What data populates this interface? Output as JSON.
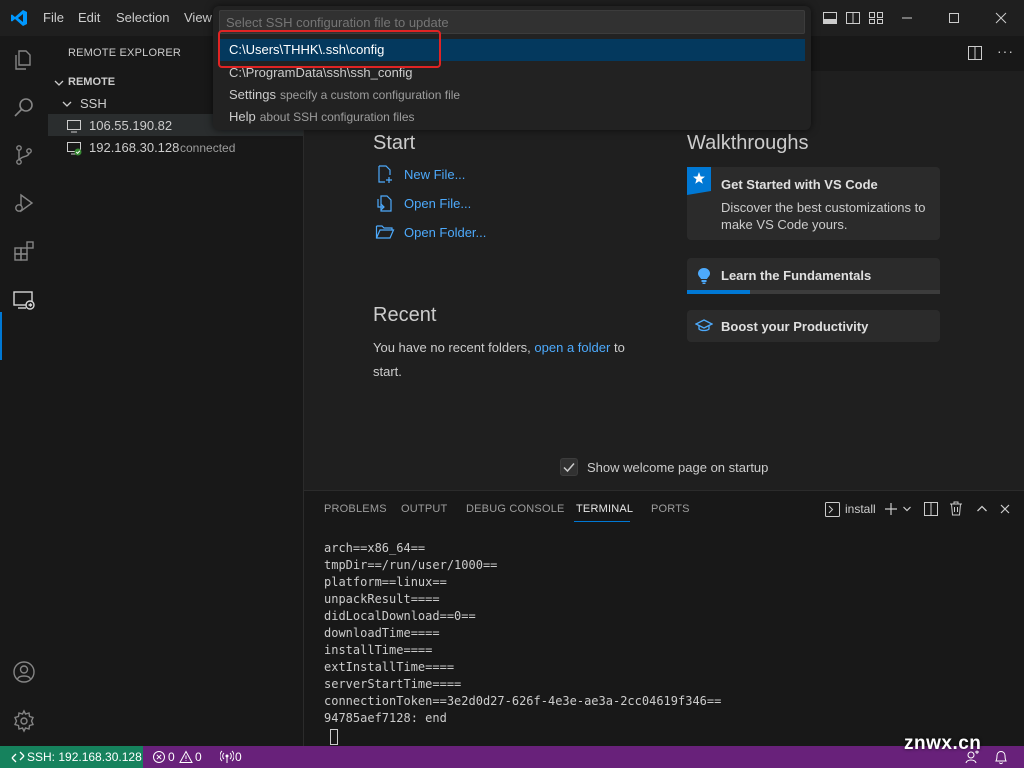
{
  "titlebar": {
    "menu": [
      "File",
      "Edit",
      "Selection",
      "View"
    ]
  },
  "quick_pick": {
    "placeholder": "Select SSH configuration file to update",
    "items": [
      {
        "label": "C:\\Users\\THHK\\.ssh\\config",
        "description": ""
      },
      {
        "label": "C:\\ProgramData\\ssh\\ssh_config",
        "description": ""
      },
      {
        "label": "Settings",
        "description": "specify a custom configuration file"
      },
      {
        "label": "Help",
        "description": "about SSH configuration files"
      }
    ]
  },
  "sidebar": {
    "title": "REMOTE EXPLORER",
    "section": "REMOTE",
    "group": "SSH",
    "hosts": [
      {
        "name": "106.55.190.82",
        "status": ""
      },
      {
        "name": "192.168.30.128",
        "status": "connected"
      }
    ]
  },
  "welcome": {
    "start_heading": "Start",
    "start_links": [
      "New File...",
      "Open File...",
      "Open Folder..."
    ],
    "recent_heading": "Recent",
    "recent_text_before": "You have no recent folders,",
    "recent_link": "open a folder",
    "recent_text_after": "to",
    "recent_text_end": "start.",
    "walkthroughs_heading": "Walkthroughs",
    "walkthroughs": [
      {
        "title": "Get Started with VS Code",
        "description": "Discover the best customizations to make VS Code yours.",
        "progress": 0
      },
      {
        "title": "Learn the Fundamentals",
        "description": "",
        "progress": 0.25
      },
      {
        "title": "Boost your Productivity",
        "description": "",
        "progress": 0
      }
    ],
    "show_on_startup_label": "Show welcome page on startup",
    "show_on_startup_checked": true
  },
  "panel": {
    "tabs": [
      "PROBLEMS",
      "OUTPUT",
      "DEBUG CONSOLE",
      "TERMINAL",
      "PORTS"
    ],
    "active_tab": "TERMINAL",
    "terminal_name": "install",
    "terminal_lines": [
      "arch==x86_64==",
      "tmpDir==/run/user/1000==",
      "platform==linux==",
      "unpackResult====",
      "didLocalDownload==0==",
      "downloadTime====",
      "installTime====",
      "extInstallTime====",
      "serverStartTime====",
      "connectionToken==3e2d0d27-626f-4e3e-ae3a-2cc04619f346==",
      "94785aef7128: end"
    ]
  },
  "statusbar": {
    "remote": "SSH: 192.168.30.128",
    "errors": "0",
    "warnings": "0",
    "ports": "0"
  },
  "watermark": "znwx.cn",
  "colors": {
    "accent": "#0078d4",
    "link": "#4daafc",
    "statusbar": "#68217a",
    "remote_indicator": "#16825d",
    "highlight_box": "#e02424",
    "selection": "#04395e"
  }
}
